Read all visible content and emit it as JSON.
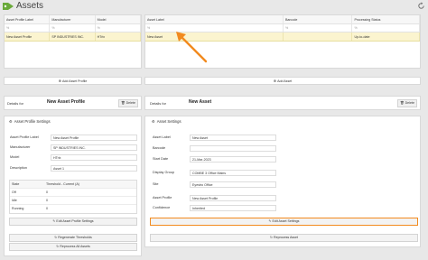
{
  "app": {
    "title": "Assets",
    "logo_icon": "tag-icon",
    "refresh_icon": "refresh-icon"
  },
  "profile_grid": {
    "columns": [
      "Asset Profile Label",
      "Manufacturer",
      "Model"
    ],
    "filter_placeholders": [
      "%",
      "%",
      "%"
    ],
    "selected_row": [
      "New Asset Profile",
      "SP INDUSTRIES INC.",
      "HTrix"
    ]
  },
  "asset_grid": {
    "columns": [
      "Asset Label",
      "Barcode",
      "Processing Status"
    ],
    "filter_placeholders": [
      "%",
      "%",
      "%"
    ],
    "selected_row": [
      "New Asset",
      "",
      "Up-to-date"
    ]
  },
  "buttons": {
    "add_asset_profile": "Add Asset Profile",
    "add_asset": "Add Asset",
    "delete": "Delete",
    "edit_asset_profile_settings": "Edit Asset Profile Settings",
    "regenerate_thresholds": "Regenerate Thresholds",
    "reprocess_all_assets": "Reprocess All Assets",
    "edit_asset_settings": "Edit Asset Settings",
    "reprocess_asset": "Reprocess Asset"
  },
  "profile_details": {
    "details_for_label": "Details for",
    "name": "New Asset Profile",
    "settings_title": "Asset Profile Settings",
    "fields": [
      {
        "label": "Asset Profile Label",
        "value": "New Asset Profile"
      },
      {
        "label": "Manufacturer",
        "value": "SP INDUSTRIES INC."
      },
      {
        "label": "Model",
        "value": "HTrix"
      },
      {
        "label": "Description",
        "value": "Asset 1"
      }
    ],
    "thresholds": {
      "headers": [
        "State",
        "Threshold - Current (A)"
      ],
      "rows": [
        [
          "Off",
          "0"
        ],
        [
          "Idle",
          "0"
        ],
        [
          "Running",
          "0"
        ]
      ]
    }
  },
  "asset_details": {
    "details_for_label": "Details for",
    "name": "New Asset",
    "settings_title": "Asset Settings",
    "fields": [
      {
        "label": "Asset Label",
        "value": "New Asset"
      },
      {
        "label": "Barcode",
        "value": ""
      },
      {
        "label": "Start Date",
        "value": "21-Mar-2023"
      },
      {
        "label": "Display Group",
        "value": "COMBE 3 Office Mains"
      },
      {
        "label": "Site",
        "value": "Eyestro Office"
      },
      {
        "label": "Asset Profile",
        "value": "New Asset Profile"
      },
      {
        "label": "Confidence",
        "value": "Inherited"
      }
    ]
  },
  "colors": {
    "highlight": "#f28a1e",
    "selected_row": "#fbf4cf",
    "accent": "#5cb85c"
  }
}
